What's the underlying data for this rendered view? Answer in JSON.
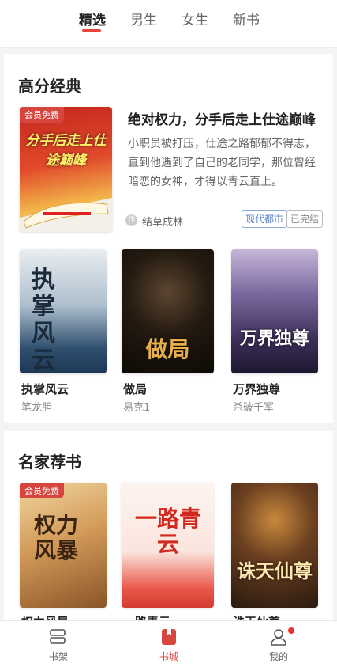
{
  "tabs": [
    "精选",
    "男生",
    "女生",
    "新书"
  ],
  "section1": {
    "title": "高分经典",
    "featured": {
      "badge": "会员免费",
      "cover_text": "分手后走上仕途巅峰",
      "title": "绝对权力，分手后走上仕途巅峰",
      "description": "小职员被打压，仕途之路郁郁不得志，直到他遇到了自己的老同学，那位曾经暗恋的女神，才得以青云直上。",
      "author": "结草成林",
      "tags": [
        "现代都市",
        "已完结"
      ]
    },
    "books": [
      {
        "name": "执掌风云",
        "author": "笔龙胆",
        "cover_text": "执掌风云"
      },
      {
        "name": "做局",
        "author": "易克1",
        "cover_text": "做局"
      },
      {
        "name": "万界独尊",
        "author": "杀破千军",
        "cover_text": "万界独尊"
      }
    ]
  },
  "section2": {
    "title": "名家荐书",
    "books": [
      {
        "name": "权力风暴",
        "badge": "会员免费",
        "cover_text": "权力风暴"
      },
      {
        "name": "一路青云",
        "cover_text": "一路青云"
      },
      {
        "name": "诛天仙尊",
        "cover_text": "诛天仙尊"
      }
    ]
  },
  "bottom_nav": [
    "书架",
    "书城",
    "我的"
  ],
  "colors": {
    "accent": "#e8453c",
    "vip": "#d7463e"
  }
}
